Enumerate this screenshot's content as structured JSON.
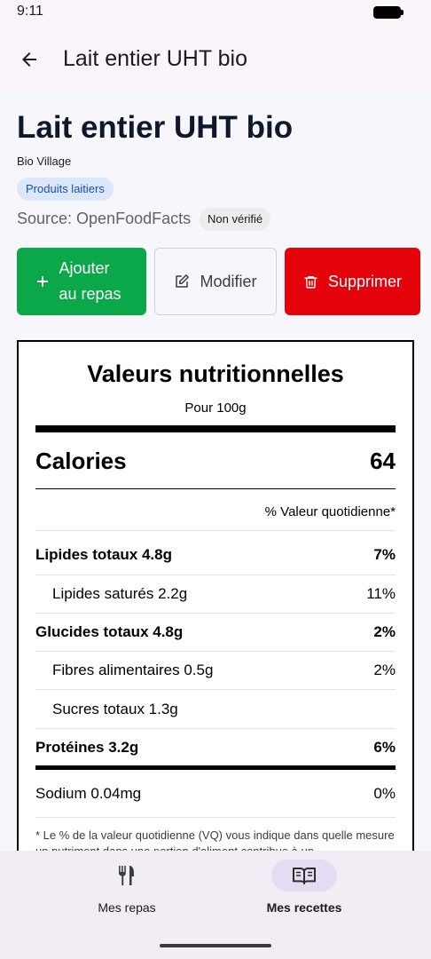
{
  "status": {
    "time": "9:11"
  },
  "app_bar": {
    "title": "Lait entier UHT bio"
  },
  "food": {
    "name": "Lait entier UHT bio",
    "brand": "Bio Village",
    "category": "Produits laitiers",
    "source": "Source: OpenFoodFacts",
    "verification": "Non vérifié"
  },
  "actions": {
    "add_label": "Ajouter au repas",
    "edit_label": "Modifier",
    "delete_label": "Supprimer"
  },
  "nutrition": {
    "title": "Valeurs nutritionnelles",
    "serving": "Pour 100g",
    "calories_label": "Calories",
    "calories_value": "64",
    "dv_header": "% Valeur quotidienne*",
    "rows": [
      {
        "label": "Lipides totaux 4.8g",
        "dv": "7%"
      },
      {
        "label": "Lipides saturés 2.2g",
        "dv": "11%"
      },
      {
        "label": "Glucides totaux 4.8g",
        "dv": "2%"
      },
      {
        "label": "Fibres alimentaires 0.5g",
        "dv": "2%"
      },
      {
        "label": "Sucres totaux 1.3g",
        "dv": ""
      },
      {
        "label": "Protéines 3.2g",
        "dv": "6%"
      },
      {
        "label": "Sodium 0.04mg",
        "dv": "0%"
      }
    ],
    "footnote": "* Le % de la valeur quotidienne (VQ) vous indique dans quelle mesure un nutriment dans une portion d'aliment contribue à un"
  },
  "bottom_nav": {
    "items": [
      {
        "label": "Mes repas",
        "icon": "fork-knife-icon"
      },
      {
        "label": "Mes recettes",
        "icon": "book-icon",
        "selected": true
      }
    ]
  },
  "colors": {
    "add_button": "#0ba84a",
    "delete_button": "#e4030b",
    "chip_bg": "#dbe7fb",
    "chip_text": "#1e4db7",
    "nav_indicator": "#e5dcf2"
  }
}
